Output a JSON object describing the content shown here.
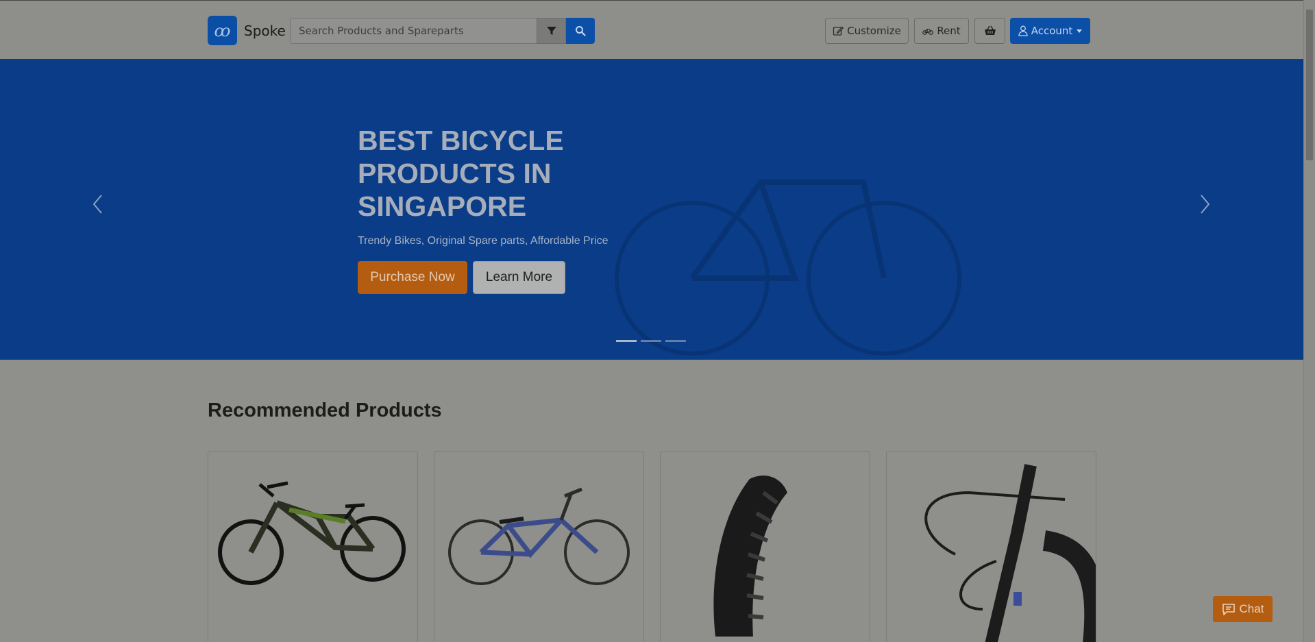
{
  "header": {
    "brand_name": "Spoke",
    "logo_glyph": "ꝏ",
    "search_placeholder": "Search Products and Spareparts",
    "filter_icon": "filter-icon",
    "search_icon": "search-icon",
    "customize_label": "Customize",
    "rent_label": "Rent",
    "cart_icon": "basket-icon",
    "account_label": "Account"
  },
  "hero": {
    "title": "BEST BICYCLE PRODUCTS IN SINGAPORE",
    "subtitle": "Trendy Bikes, Original Spare parts, Affordable Price",
    "purchase_label": "Purchase Now",
    "learn_label": "Learn More",
    "slide_count": 3,
    "active_slide": 1
  },
  "recommended": {
    "title": "Recommended Products",
    "products": [
      {
        "image": "mountain-bike-full-suspension"
      },
      {
        "image": "blue-hardtail-bike"
      },
      {
        "image": "mountain-bike-tire"
      },
      {
        "image": "handlebar-closeup"
      }
    ]
  },
  "chat": {
    "label": "Chat"
  },
  "colors": {
    "brand_blue": "#0c4fa7",
    "hero_blue": "#0a3c87",
    "accent_orange": "#b45d10",
    "overlay_gray": "#8f8f8b"
  }
}
